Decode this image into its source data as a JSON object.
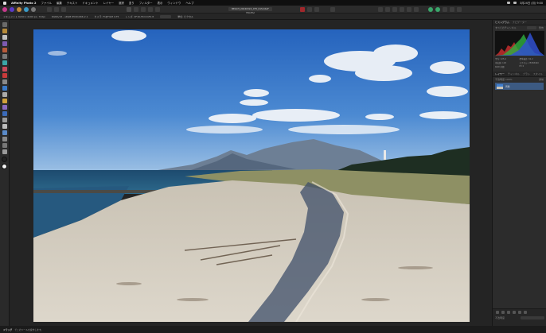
{
  "menubar": {
    "app_name": "Affinity Photo 2",
    "items": [
      "ファイル",
      "編集",
      "テキスト",
      "ドキュメント",
      "レイヤー",
      "選択",
      "塗り",
      "フィルター",
      "表示",
      "ウィンドウ",
      "ヘルプ"
    ],
    "clock": "3月24日 (月) 9:00"
  },
  "toolbar": {
    "document_title": "BEACH_20240324_XT5_0152.RAF (54.2%)"
  },
  "context": {
    "fields": [
      "ドキュメント 6240 x 4160 px, 72dpi",
      "RGBA/16 - sRGB IEC61966-2.1",
      "カメラ: FUJIFILM X-T5",
      "レンズ: XF16-55mmF2.8",
      "単位: ピクセル"
    ]
  },
  "right_panel": {
    "top_tabs": [
      "ヒストグラム",
      "ナビゲーター"
    ],
    "hist_tabs": [
      "すべてのチャンネル",
      "警告"
    ],
    "stats": [
      "平均: 125.4",
      "標準偏差: 61.2",
      "中央値: 118",
      "ピクセル: 25958400",
      "RAW 詳細",
      "EV 0"
    ],
    "layer_tabs": [
      "レイヤー",
      "チャンネル",
      "ブラシ",
      "スタイル"
    ],
    "blend_mode": "通常",
    "opacity": "不透明度 100%",
    "layer_name": "背景",
    "bottom_label": "不透明度"
  },
  "status": {
    "mode_label": "ドラッグ",
    "hint": "でこのツールを操作します。"
  },
  "colors": {
    "accent": "#3c5a82",
    "sky_top": "#2c6cc4",
    "sand": "#cfc8bb"
  },
  "icons": [
    "apple-icon",
    "wifi-icon",
    "battery-icon",
    "move-tool-icon",
    "crop-tool-icon",
    "brush-tool-icon",
    "eraser-tool-icon",
    "zoom-tool-icon",
    "layer-add-icon",
    "trash-icon"
  ]
}
